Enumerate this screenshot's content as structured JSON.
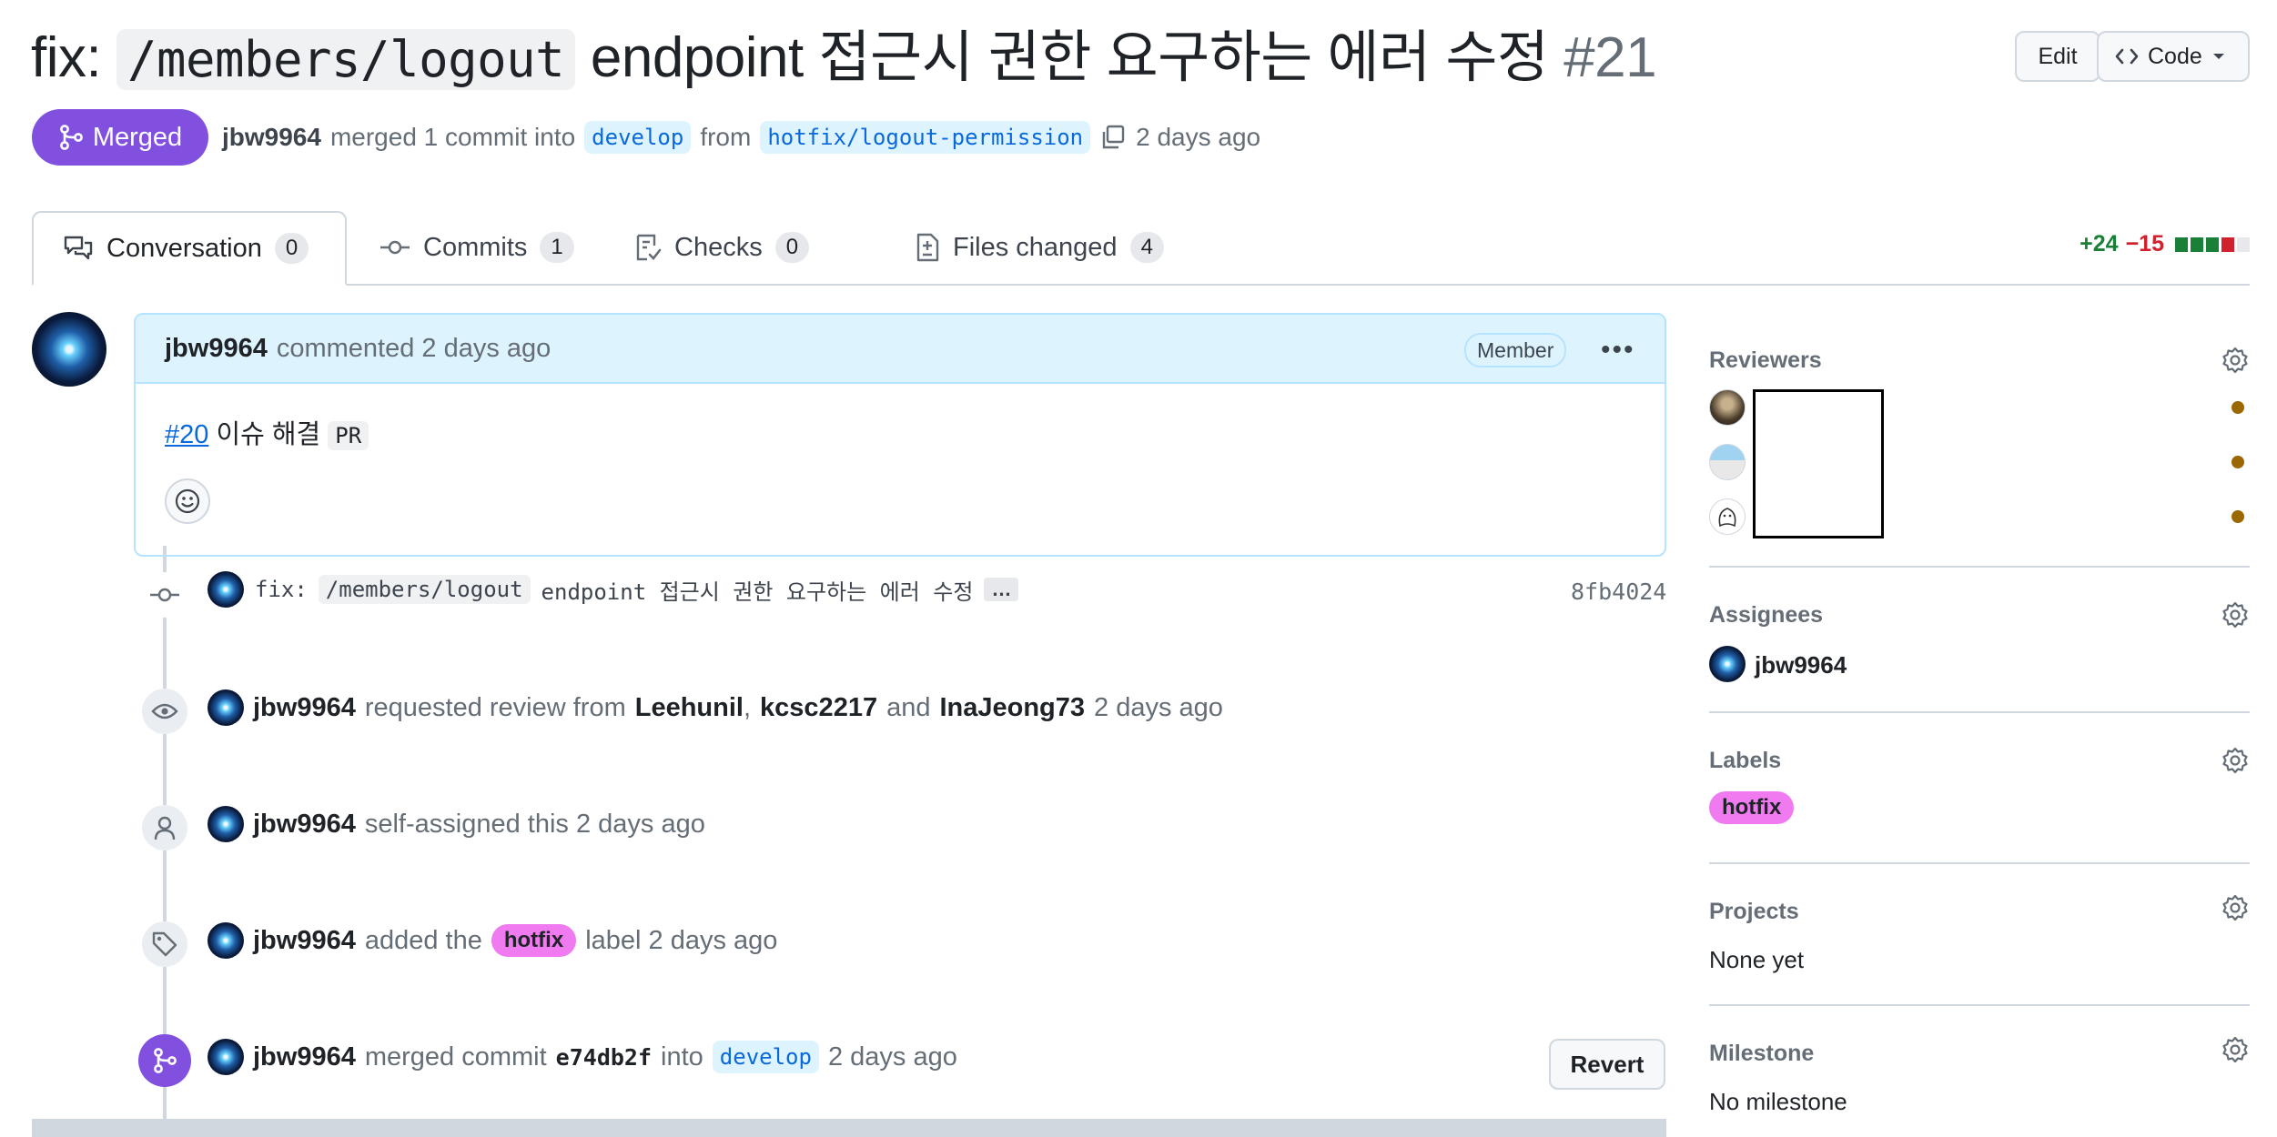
{
  "pr": {
    "title_prefix": "fix:",
    "title_path": "/members/logout",
    "title_rest": "endpoint 접근시 권한 요구하는 에러 수정",
    "number": "#21",
    "status": "Merged",
    "author": "jbw9964",
    "merge_text": "merged 1 commit into",
    "base_branch": "develop",
    "from_text": "from",
    "head_branch": "hotfix/logout-permission",
    "time": "2 days ago"
  },
  "header_buttons": {
    "edit": "Edit",
    "code": "Code"
  },
  "tabs": [
    {
      "label": "Conversation",
      "count": "0"
    },
    {
      "label": "Commits",
      "count": "1"
    },
    {
      "label": "Checks",
      "count": "0"
    },
    {
      "label": "Files changed",
      "count": "4"
    }
  ],
  "diffstat": {
    "additions": "+24",
    "deletions": "−15",
    "colors": [
      "#1a7f37",
      "#1a7f37",
      "#1a7f37",
      "#cf222e",
      "#e6e8eb"
    ]
  },
  "comment": {
    "author": "jbw9964",
    "action": "commented 2 days ago",
    "badge": "Member",
    "more": "•••",
    "issue_link": "#20",
    "body_text": "이슈 해결",
    "body_code": "PR"
  },
  "commit": {
    "prefix": "fix:",
    "path": "/members/logout",
    "rest": "endpoint 접근시 권한 요구하는 에러 수정",
    "ellipsis": "…",
    "sha": "8fb4024"
  },
  "events": {
    "review": {
      "actor": "jbw9964",
      "text": "requested review from",
      "reviewer1": "Leehunil",
      "sep": ",",
      "reviewer2": "kcsc2217",
      "and": "and",
      "reviewer3": "InaJeong73",
      "time": "2 days ago"
    },
    "assign": {
      "actor": "jbw9964",
      "text": "self-assigned this 2 days ago"
    },
    "label": {
      "actor": "jbw9964",
      "text_before": "added the",
      "label": "hotfix",
      "text_after": "label 2 days ago"
    },
    "merge": {
      "actor": "jbw9964",
      "text": "merged commit",
      "sha": "e74db2f",
      "into": "into",
      "branch": "develop",
      "time": "2 days ago"
    }
  },
  "revert_label": "Revert",
  "sidebar": {
    "reviewers": {
      "title": "Reviewers"
    },
    "assignees": {
      "title": "Assignees",
      "user": "jbw9964"
    },
    "labels": {
      "title": "Labels",
      "label": "hotfix",
      "label_color": "#f07af0"
    },
    "projects": {
      "title": "Projects",
      "value": "None yet"
    },
    "milestone": {
      "title": "Milestone",
      "value": "No milestone"
    }
  },
  "colors": {
    "merged": "#8250df",
    "link": "#0969da",
    "branch_bg": "#ddf4ff",
    "pending_dot": "#9a6700"
  }
}
